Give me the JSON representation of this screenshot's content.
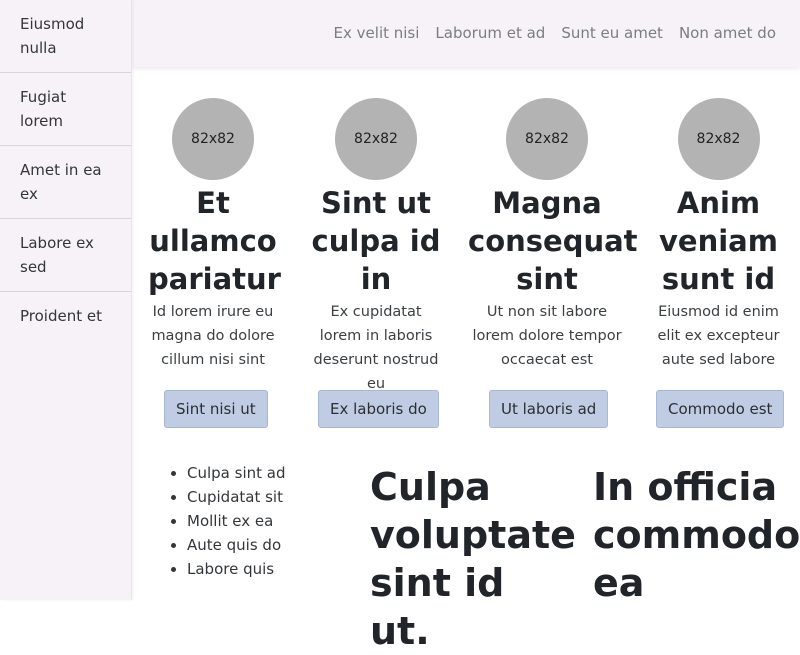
{
  "sidebar": {
    "items": [
      {
        "label": "Eiusmod nulla"
      },
      {
        "label": "Fugiat lorem"
      },
      {
        "label": "Amet in ea ex"
      },
      {
        "label": "Labore ex sed"
      },
      {
        "label": "Proident et"
      }
    ]
  },
  "topnav": {
    "links": [
      {
        "label": "Ex velit nisi"
      },
      {
        "label": "Laborum et ad"
      },
      {
        "label": "Sunt eu amet"
      },
      {
        "label": "Non amet do"
      }
    ]
  },
  "cards": [
    {
      "avatar": "82x82",
      "title": "Et ullamco pariatur",
      "text": "Id lorem irure eu magna do dolore cillum nisi sint",
      "button": "Sint nisi ut"
    },
    {
      "avatar": "82x82",
      "title": "Sint ut culpa id in",
      "text": "Ex cupidatat lorem in laboris deserunt nostrud eu",
      "button": "Ex laboris do"
    },
    {
      "avatar": "82x82",
      "title": "Magna consequat sint",
      "text": "Ut non sit labore lorem dolore tempor occaecat est",
      "button": "Ut laboris ad"
    },
    {
      "avatar": "82x82",
      "title": "Anim veniam sunt id",
      "text": "Eiusmod id enim elit ex excepteur aute sed labore",
      "button": "Commodo est"
    }
  ],
  "list": {
    "items": [
      "Culpa sint ad",
      "Cupidatat sit",
      "Mollit ex ea",
      "Aute quis do",
      "Labore quis"
    ]
  },
  "headings": [
    {
      "text": "Culpa voluptate sint id ut."
    },
    {
      "text": "In officia commodo ea"
    }
  ]
}
